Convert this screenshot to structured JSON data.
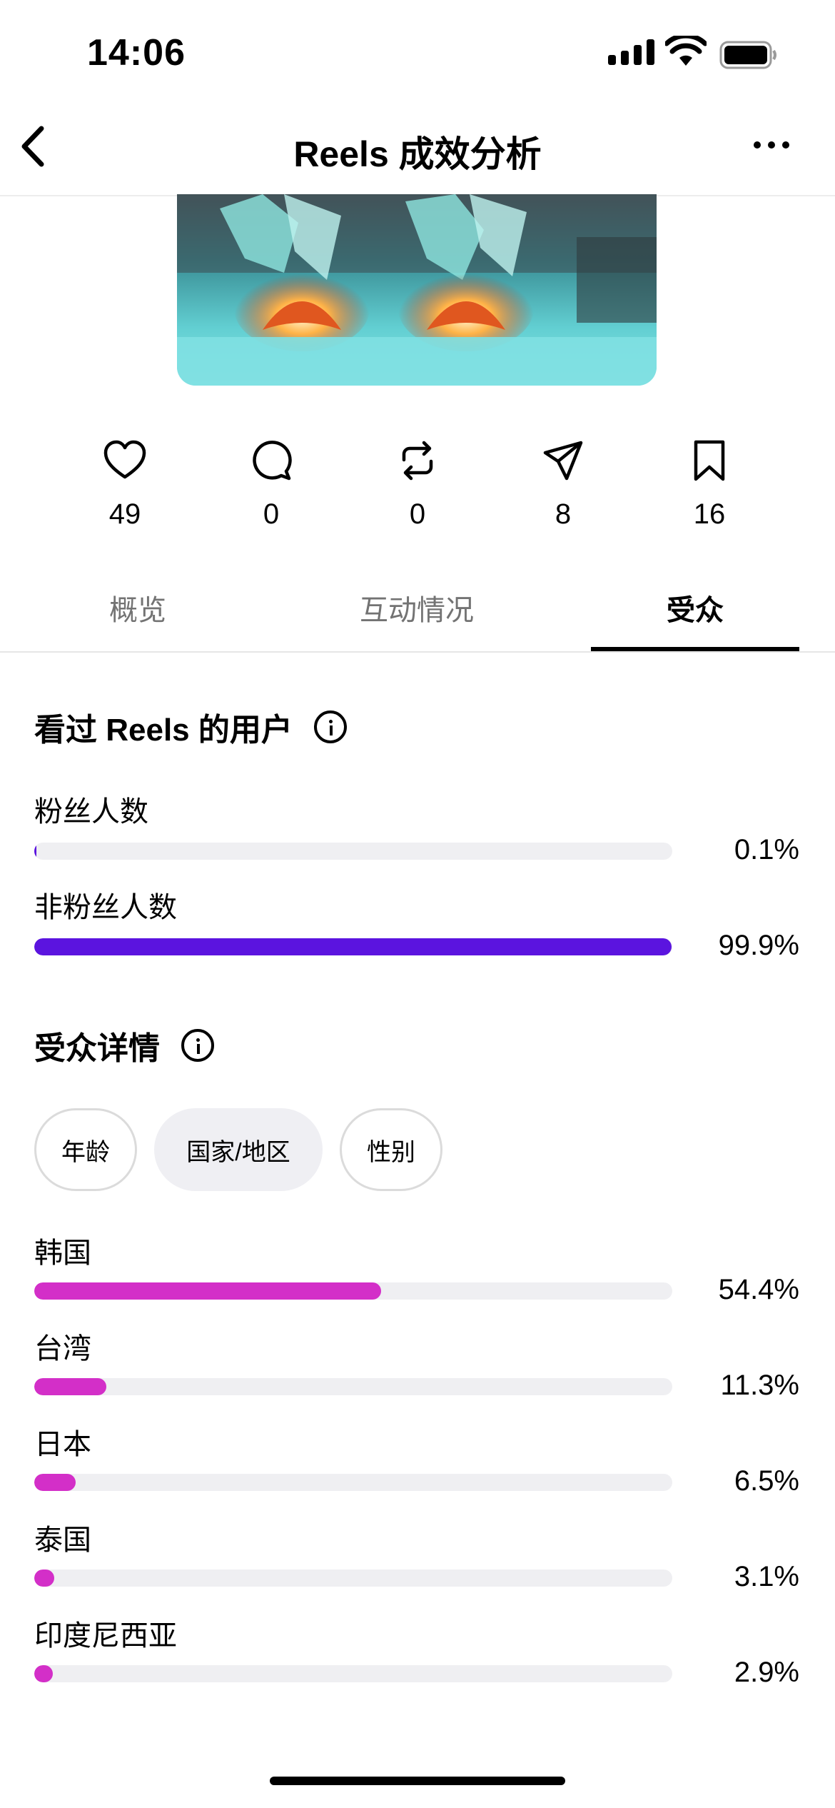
{
  "status_bar": {
    "time": "14:06"
  },
  "header": {
    "title": "Reels 成效分析"
  },
  "metrics": [
    {
      "icon": "heart-icon",
      "value": "49"
    },
    {
      "icon": "comment-icon",
      "value": "0"
    },
    {
      "icon": "repost-icon",
      "value": "0"
    },
    {
      "icon": "share-icon",
      "value": "8"
    },
    {
      "icon": "bookmark-icon",
      "value": "16"
    }
  ],
  "tabs": [
    {
      "label": "概览",
      "active": false
    },
    {
      "label": "互动情况",
      "active": false
    },
    {
      "label": "受众",
      "active": true
    }
  ],
  "viewers_section": {
    "title": "看过 Reels 的用户",
    "rows": [
      {
        "label": "粉丝人数",
        "percent_text": "0.1%",
        "percent": 0.1,
        "color": "#5b14df"
      },
      {
        "label": "非粉丝人数",
        "percent_text": "99.9%",
        "percent": 99.9,
        "color": "#5b14df"
      }
    ]
  },
  "audience_section": {
    "title": "受众详情",
    "chips": [
      {
        "label": "年龄",
        "selected": false
      },
      {
        "label": "国家/地区",
        "selected": true
      },
      {
        "label": "性别",
        "selected": false
      }
    ],
    "rows": [
      {
        "label": "韩国",
        "percent_text": "54.4%",
        "percent": 54.4,
        "color": "#d32fc8"
      },
      {
        "label": "台湾",
        "percent_text": "11.3%",
        "percent": 11.3,
        "color": "#d32fc8"
      },
      {
        "label": "日本",
        "percent_text": "6.5%",
        "percent": 6.5,
        "color": "#d32fc8"
      },
      {
        "label": "泰国",
        "percent_text": "3.1%",
        "percent": 3.1,
        "color": "#d32fc8"
      },
      {
        "label": "印度尼西亚",
        "percent_text": "2.9%",
        "percent": 2.9,
        "color": "#d32fc8"
      }
    ]
  }
}
